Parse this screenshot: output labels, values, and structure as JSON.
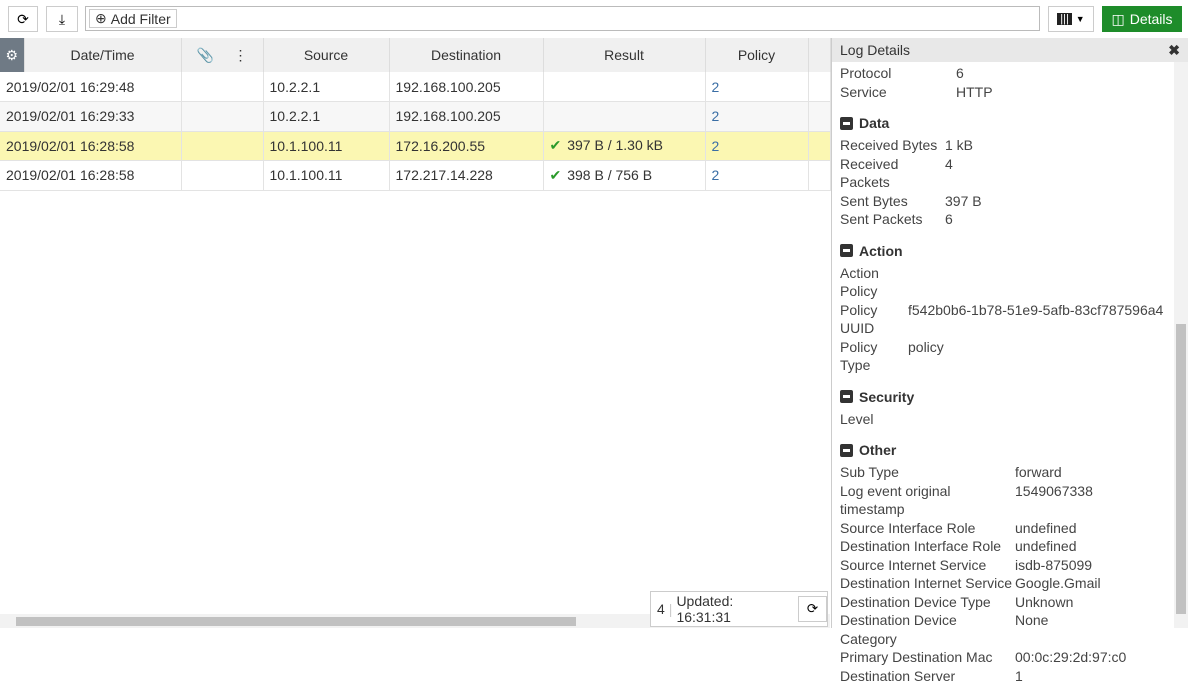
{
  "toolbar": {
    "add_filter": "Add Filter",
    "details": "Details"
  },
  "columns": [
    "Date/Time",
    "Source",
    "Destination",
    "Result",
    "Policy"
  ],
  "rows": [
    {
      "datetime": "2019/02/01 16:29:48",
      "source": "10.2.2.1",
      "destination": "192.168.100.205",
      "result": "",
      "policy": "2"
    },
    {
      "datetime": "2019/02/01 16:29:33",
      "source": "10.2.2.1",
      "destination": "192.168.100.205",
      "result": "",
      "policy": "2"
    },
    {
      "datetime": "2019/02/01 16:28:58",
      "source": "10.1.100.11",
      "destination": "172.16.200.55",
      "result": "397 B / 1.30 kB",
      "policy": "2"
    },
    {
      "datetime": "2019/02/01 16:28:58",
      "source": "10.1.100.11",
      "destination": "172.217.14.228",
      "result": "398 B / 756 B",
      "policy": "2"
    }
  ],
  "status": {
    "count": "4",
    "updated": "Updated: 16:31:31"
  },
  "panel": {
    "title": "Log Details",
    "top": [
      [
        "Protocol",
        "6"
      ],
      [
        "Service",
        "HTTP"
      ]
    ],
    "data_title": "Data",
    "data": [
      [
        "Received Bytes",
        "1 kB"
      ],
      [
        "Received Packets",
        "4"
      ],
      [
        "Sent Bytes",
        "397 B"
      ],
      [
        "Sent Packets",
        "6"
      ]
    ],
    "action_title": "Action",
    "action": [
      [
        "Action",
        ""
      ],
      [
        "Policy",
        ""
      ],
      [
        "Policy UUID",
        "f542b0b6-1b78-51e9-5afb-83cf787596a4"
      ],
      [
        "Policy Type",
        "policy"
      ]
    ],
    "security_title": "Security",
    "security": [
      [
        "Level",
        ""
      ]
    ],
    "other_title": "Other",
    "other": [
      [
        "Sub Type",
        "forward"
      ],
      [
        "Log event original timestamp",
        "1549067338"
      ],
      [
        "Source Interface Role",
        "undefined"
      ],
      [
        "Destination Interface Role",
        "undefined"
      ],
      [
        "Source Internet Service",
        "isdb-875099"
      ],
      [
        "Destination Internet Service",
        "Google.Gmail"
      ],
      [
        "Destination Device Type",
        "Unknown"
      ],
      [
        "Destination Device Category",
        "None"
      ],
      [
        "Primary Destination Mac",
        "00:0c:29:2d:97:c0"
      ],
      [
        "Destination Server",
        "1"
      ]
    ]
  }
}
